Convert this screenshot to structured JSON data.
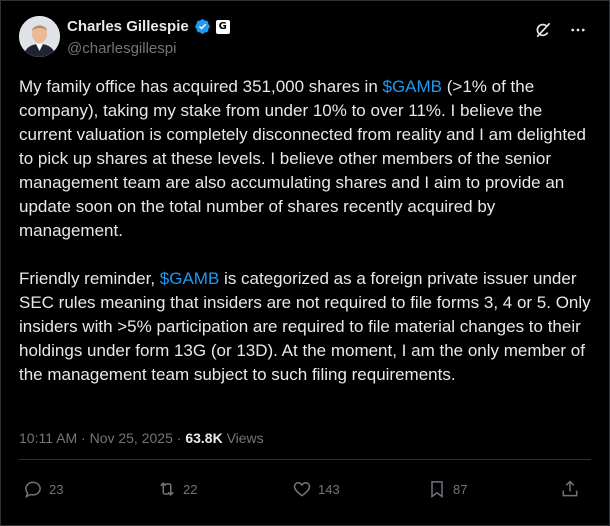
{
  "author": {
    "name": "Charles Gillespie",
    "handle": "@charlesgillespi",
    "affiliation_badge": "G"
  },
  "icons": {
    "verified": "verified-badge-icon",
    "grok": "grok-icon",
    "more": "more-options-icon"
  },
  "tweet": {
    "p1": {
      "pre": "My family office has acquired 351,000 shares in ",
      "cashtag": "$GAMB",
      "post": " (>1% of the company), taking my stake from under 10% to over 11%. I believe the current valuation is completely disconnected from reality and I am delighted to pick up shares at these levels. I believe other members of the senior management team are also accumulating shares and I aim to provide an update soon on the total number of shares recently acquired by management."
    },
    "p2": {
      "pre": "Friendly reminder, ",
      "cashtag": "$GAMB",
      "post": " is categorized as a foreign private issuer under SEC rules meaning that insiders are not required to file forms 3, 4 or 5. Only insiders with >5% participation are required to file material changes to their holdings under form 13G (or 13D). At the moment, I am the only member of the management team subject to such filing requirements."
    }
  },
  "meta": {
    "time": "10:11 AM",
    "separator": " · ",
    "date": "Nov 25, 2025",
    "views_count": "63.8K",
    "views_label": "Views"
  },
  "actions": {
    "replies": "23",
    "reposts": "22",
    "likes": "143",
    "bookmarks": "87"
  },
  "colors": {
    "background": "#000000",
    "text": "#e7e9ea",
    "muted": "#71767b",
    "link": "#1d9bf0",
    "verified": "#1d9bf0"
  }
}
